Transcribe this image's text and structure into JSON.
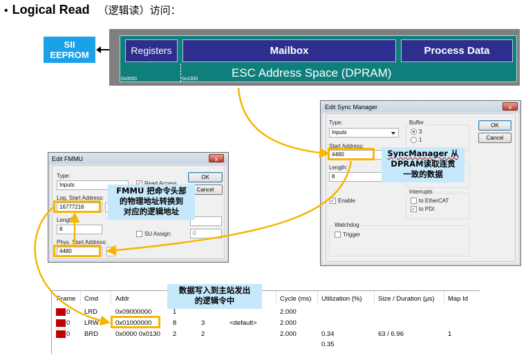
{
  "title": {
    "bullet": "•",
    "bold": "Logical Read",
    "cn": "（逻辑读）访问："
  },
  "diagram": {
    "eeprom_line1": "SII",
    "eeprom_line2": "EEPROM",
    "registers": "Registers",
    "mailbox": "Mailbox",
    "process_data": "Process Data",
    "esc_label": "ESC Address Space (DPRAM)",
    "addr_start": "0x0000",
    "addr_mailbox": "0x1000"
  },
  "sync_manager": {
    "title": "Edit Sync Manager",
    "close": "x",
    "type_label": "Type:",
    "type_value": "Inputs",
    "buffer_label": "Buffer",
    "buffer_options": [
      "3",
      "1"
    ],
    "buffer_selected": "3",
    "ok": "OK",
    "cancel": "Cancel",
    "start_label": "Start Address:",
    "start_value": "4480",
    "length_label": "Length:",
    "length_value": "8",
    "enable_label": "Enable",
    "enable_checked": true,
    "interrupts_label": "Interrupts",
    "to_ethercat": "to EtherCAT",
    "to_ethercat_checked": false,
    "to_pdi": "to PDI",
    "to_pdi_checked": true,
    "watchdog_label": "Watchdog",
    "trigger_label": "Trigger",
    "trigger_checked": false
  },
  "fmmu": {
    "title": "Edit FMMU",
    "close": "x",
    "type_label": "Type:",
    "type_value": "Inputs",
    "read_access": "Read Access",
    "read_access_checked": true,
    "ok": "OK",
    "cancel": "Cancel",
    "log_start_label": "Log. Start Address:",
    "log_start_value": "16777216",
    "log_bit": "0",
    "length_label": "Length:",
    "length_value": "8",
    "su_assign": "SU Assign:",
    "su_assign_value": "0",
    "phys_start_label": "Phys. Start Address:",
    "phys_start_value": "4480"
  },
  "callouts": {
    "sync_line1": "SyncManager 从",
    "sync_line2": "DPRAM读取连贯",
    "sync_line3": "一致的数据",
    "fmmu_line1": "FMMU 把命令头部",
    "fmmu_line2": "的物理地址转换到",
    "fmmu_line3": "对应的逻辑地址",
    "cmd_line1": "数据写入到主站发出",
    "cmd_line2": "的逻辑令中"
  },
  "table": {
    "headers": [
      "Frame",
      "Cmd",
      "Addr",
      "Cycle (ms)",
      "Utilization (%)",
      "Size / Duration (µs)",
      "Map Id"
    ],
    "rows": [
      {
        "frame": "0",
        "cmd": "LRD",
        "addr": "0x09000000",
        "c4": "1",
        "c5": "",
        "c6": "",
        "cycle": "2.000",
        "util": "",
        "size": "",
        "map": ""
      },
      {
        "frame": "0",
        "cmd": "LRW",
        "addr": "0x01000000",
        "c4": "8",
        "c5": "3",
        "c6": "<default>",
        "cycle": "2.000",
        "util": "",
        "size": "",
        "map": ""
      },
      {
        "frame": "0",
        "cmd": "BRD",
        "addr": "0x0000 0x0130",
        "c4": "2",
        "c5": "2",
        "c6": "",
        "cycle": "2.000",
        "util": "0.34",
        "size": "63 / 6.96",
        "map": "1"
      }
    ],
    "extra_util": "0.35"
  },
  "colors": {
    "highlight": "#f7b500",
    "callout_bg": "#c6e8fb",
    "dpram_bg": "#0f7f7c",
    "block_bg": "#2e2e8f",
    "eeprom_bg": "#1ca0e8",
    "frame_icon": "#c00000"
  }
}
